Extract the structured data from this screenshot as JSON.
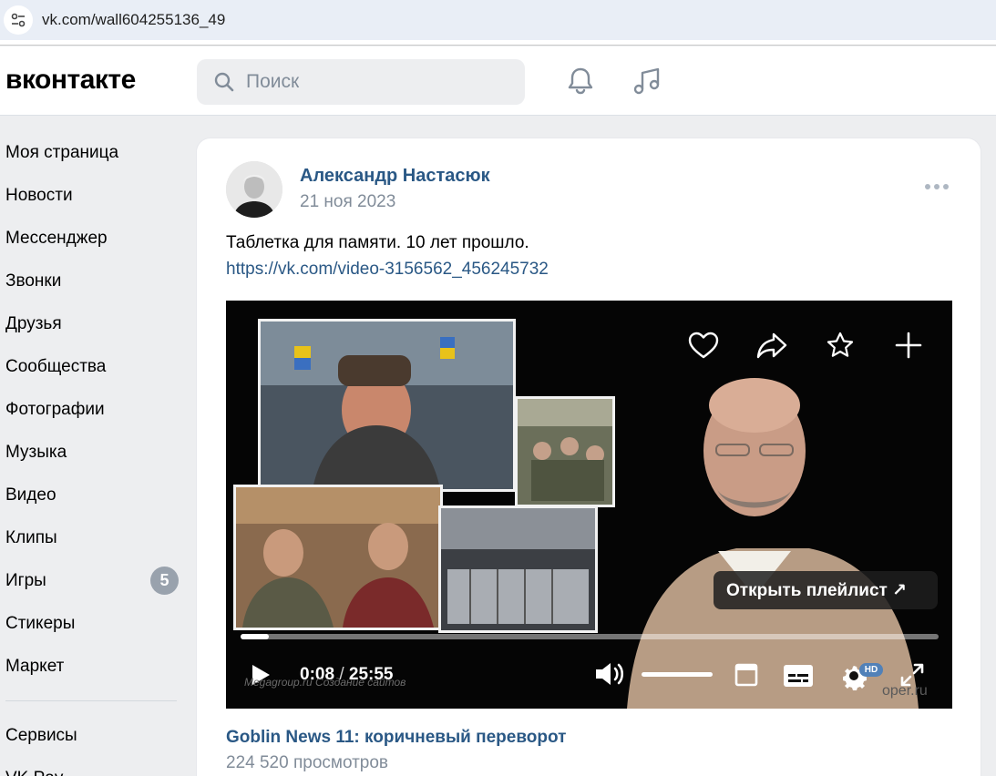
{
  "browser": {
    "url": "vk.com/wall604255136_49"
  },
  "header": {
    "logo": "вконтакте",
    "search_placeholder": "Поиск"
  },
  "sidebar": {
    "items": [
      {
        "label": "Моя страница"
      },
      {
        "label": "Новости"
      },
      {
        "label": "Мессенджер"
      },
      {
        "label": "Звонки"
      },
      {
        "label": "Друзья"
      },
      {
        "label": "Сообщества"
      },
      {
        "label": "Фотографии"
      },
      {
        "label": "Музыка"
      },
      {
        "label": "Видео"
      },
      {
        "label": "Клипы"
      },
      {
        "label": "Игры",
        "badge": "5"
      },
      {
        "label": "Стикеры"
      },
      {
        "label": "Маркет"
      }
    ],
    "secondary": [
      {
        "label": "Сервисы"
      },
      {
        "label": "VK Pay"
      }
    ]
  },
  "post": {
    "author": "Александр Настасюк",
    "date": "21 ноя 2023",
    "text": "Таблетка для памяти. 10 лет прошло.",
    "link": "https://vk.com/video-3156562_456245732",
    "video": {
      "open_playlist": "Открыть плейлист ↗",
      "current_time": "0:08",
      "time_separator": "/",
      "duration": "25:55",
      "progress_fraction": 0.04,
      "volume_fraction": 1.0,
      "quality_badge": "HD",
      "watermark_left": "Megagroup.ru   Создание сайтов",
      "watermark_right": "oper.ru",
      "title": "Goblin News 11: коричневый переворот",
      "views": "224 520 просмотров"
    }
  },
  "colors": {
    "link": "#2a5885",
    "muted": "#818c99",
    "badge": "#99a2ad",
    "accent": "#5181b8"
  }
}
